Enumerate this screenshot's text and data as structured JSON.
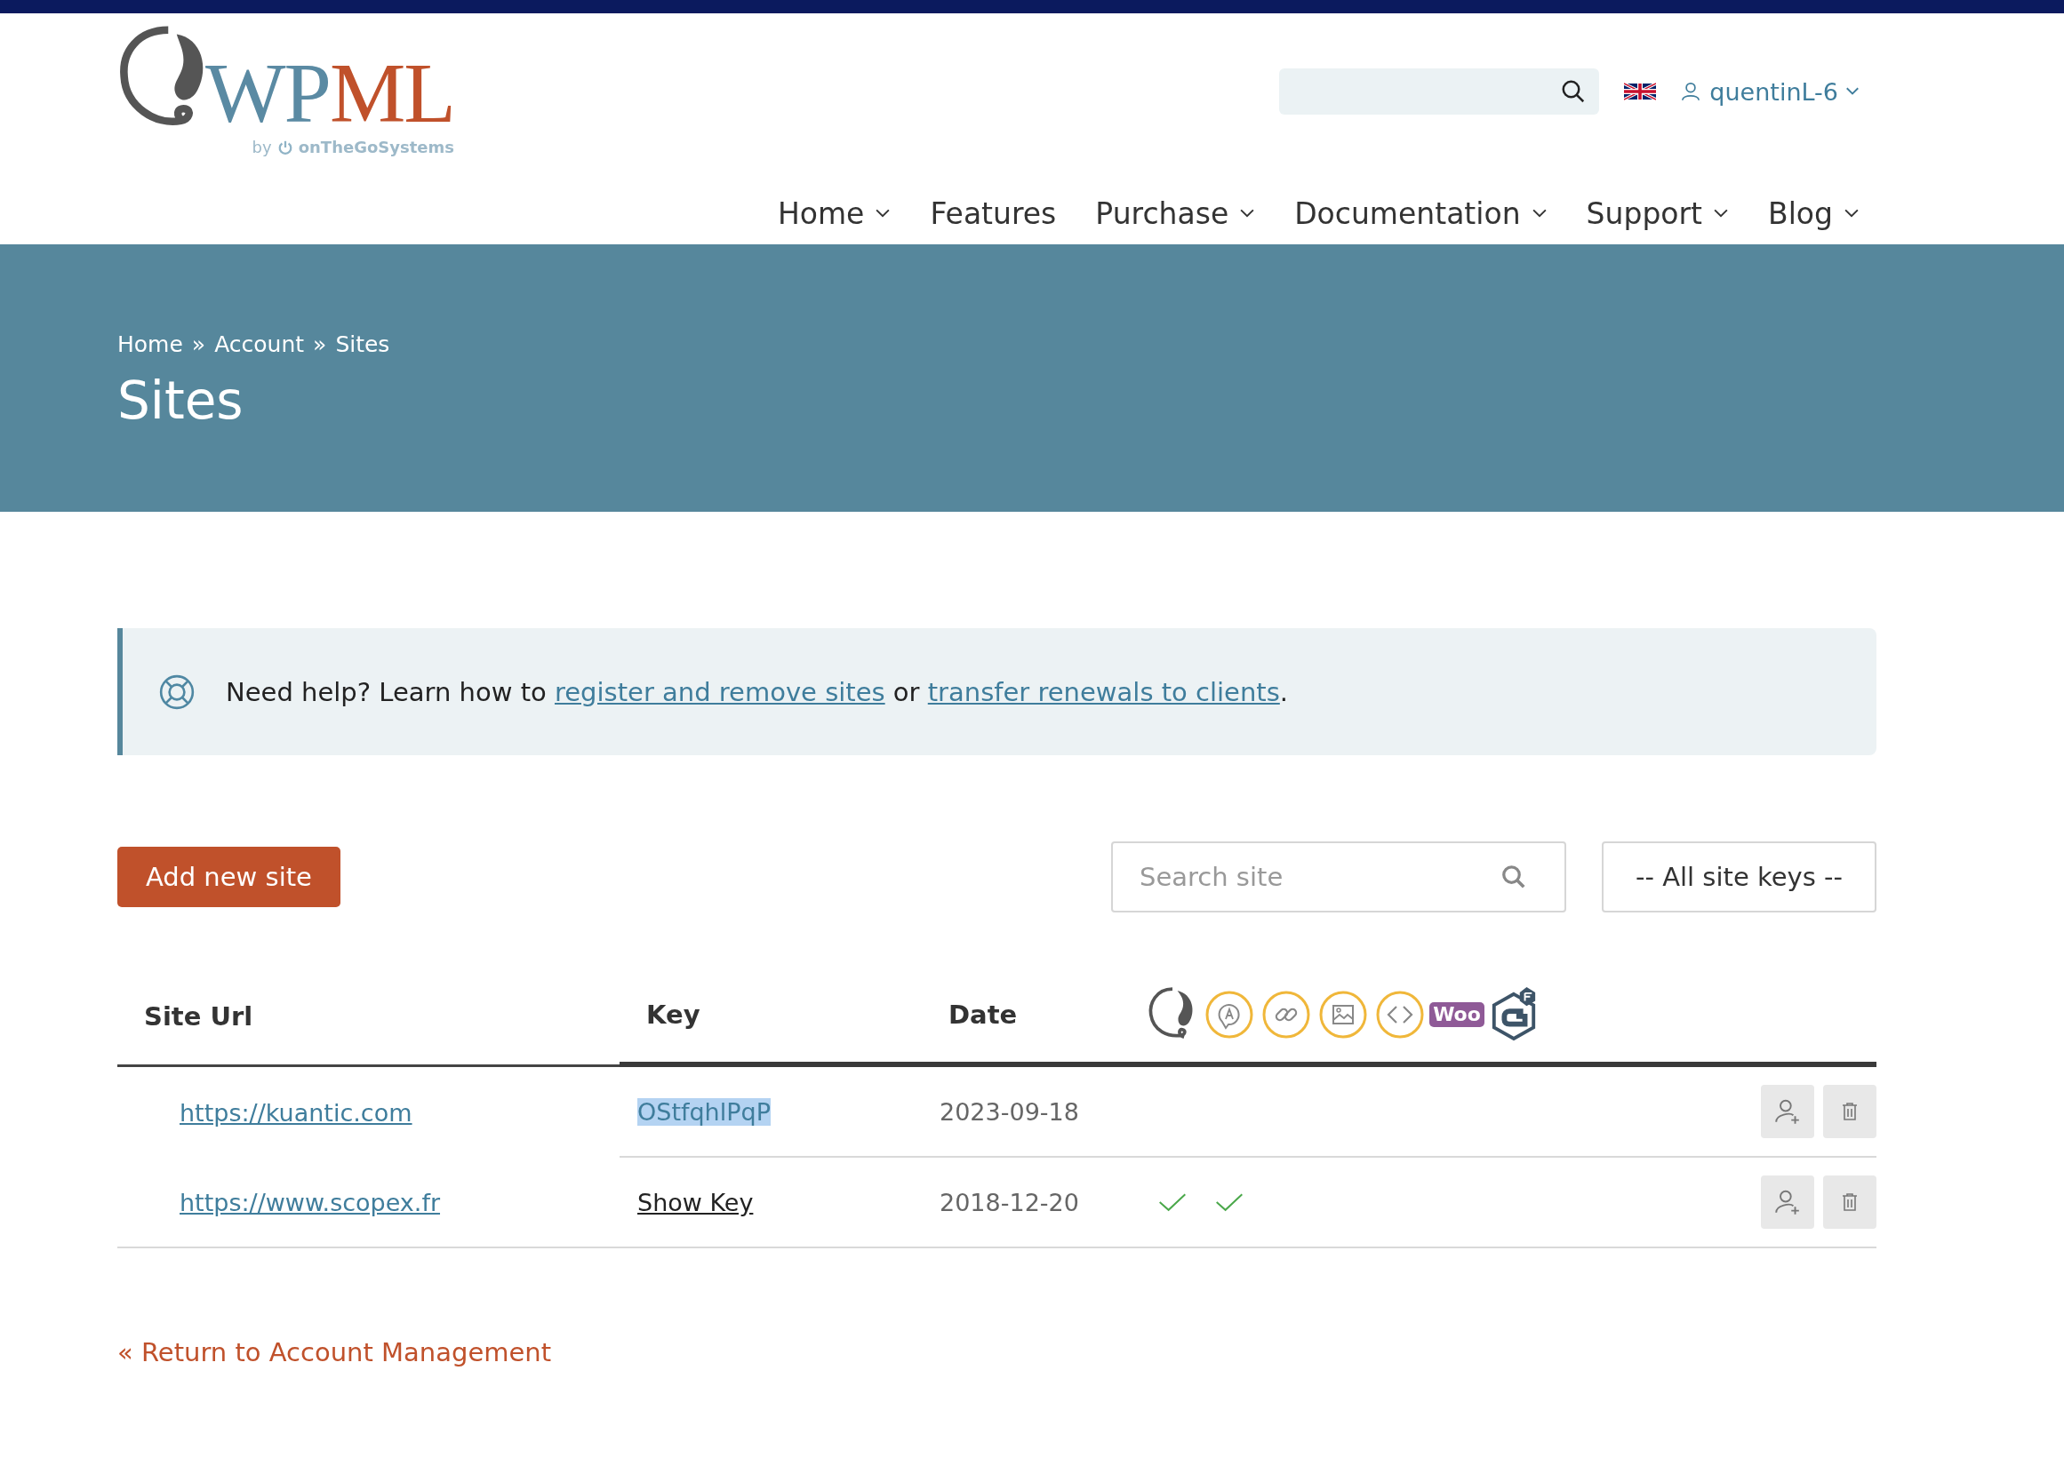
{
  "logo": {
    "primary": "WP",
    "accent": "ML",
    "byline_prefix": "by",
    "byline_brand": "onTheGoSystems"
  },
  "header": {
    "user": "quentinL-6"
  },
  "nav": [
    {
      "label": "Home",
      "has_menu": true
    },
    {
      "label": "Features",
      "has_menu": false
    },
    {
      "label": "Purchase",
      "has_menu": true
    },
    {
      "label": "Documentation",
      "has_menu": true
    },
    {
      "label": "Support",
      "has_menu": true
    },
    {
      "label": "Blog",
      "has_menu": true
    }
  ],
  "breadcrumb": [
    "Home",
    "Account",
    "Sites"
  ],
  "breadcrumb_separator": "»",
  "page_title": "Sites",
  "help": {
    "text_before": "Need help? Learn how to",
    "link_1": "register and remove sites",
    "text_between": "or",
    "link_2": "transfer renewals to clients",
    "text_after": "."
  },
  "toolbar": {
    "add_button": "Add new site",
    "search": {
      "placeholder": "Search site"
    },
    "key_filter": "-- All site keys --"
  },
  "table": {
    "columns": [
      "Site Url",
      "Key",
      "Date"
    ],
    "products": [
      {
        "kind": "wpml"
      },
      {
        "kind": "translate"
      },
      {
        "kind": "link"
      },
      {
        "kind": "image"
      },
      {
        "kind": "code"
      },
      {
        "kind": "woo",
        "label": "Woo"
      },
      {
        "kind": "gravity"
      }
    ],
    "rows": [
      {
        "url": "https://kuantic.com",
        "key": {
          "kind": "key",
          "text": "OStfqhlPqP",
          "selected": true
        },
        "date": "2023-09-18"
      },
      {
        "url": "https://www.scopex.fr",
        "key": {
          "kind": "link",
          "text": "Show Key",
          "selected": false
        },
        "date": "2018-12-20",
        "checks": [
          true,
          true
        ]
      }
    ]
  },
  "return_link": "« Return to Account Management"
}
